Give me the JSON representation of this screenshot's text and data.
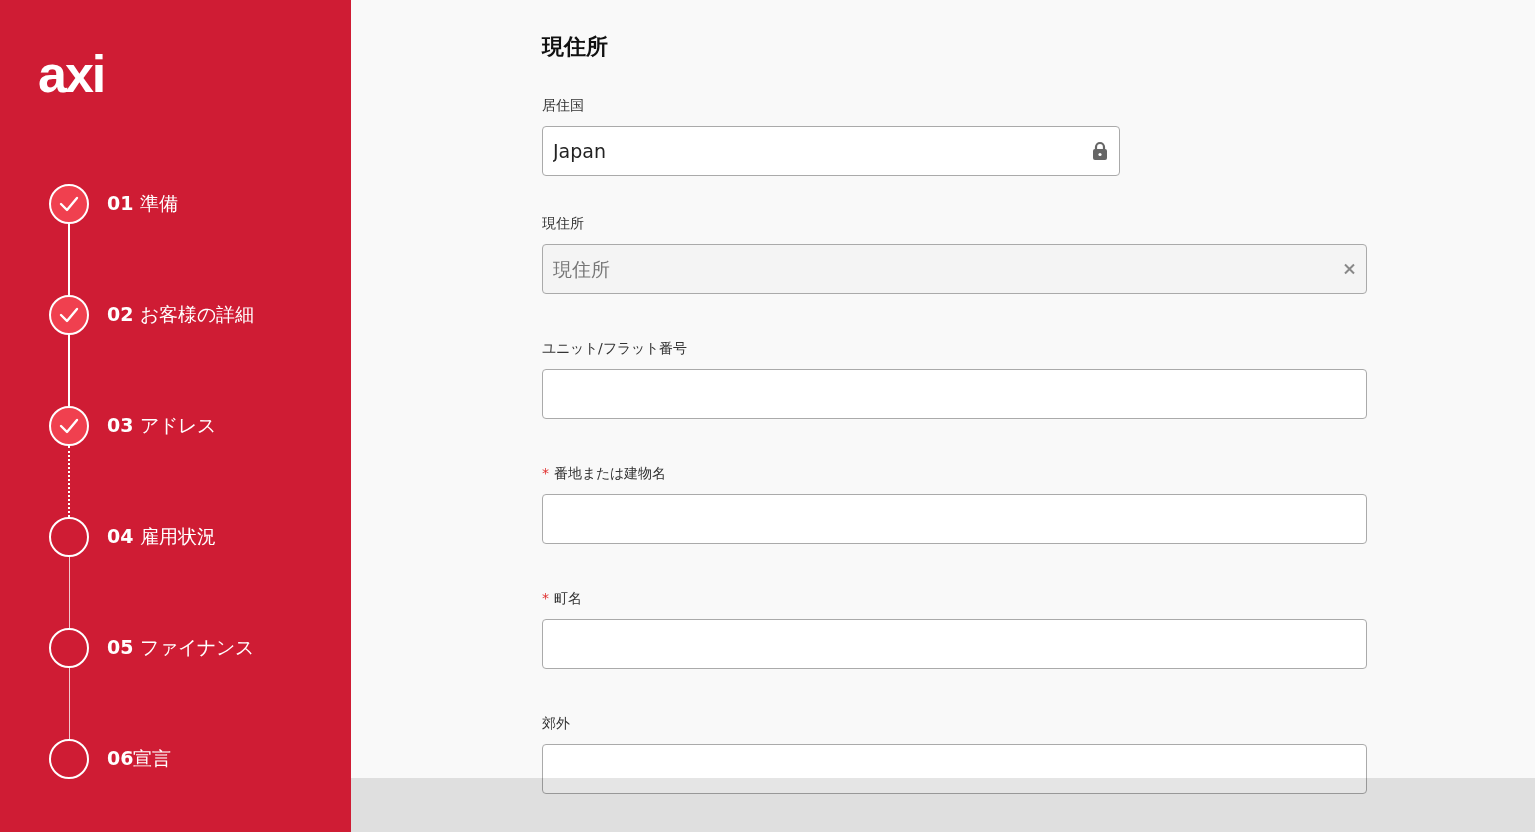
{
  "sidebar": {
    "logo": "axi",
    "steps": [
      {
        "number": "01",
        "label": "準備",
        "done": true
      },
      {
        "number": "02",
        "label": "お客様の詳細",
        "done": true
      },
      {
        "number": "03",
        "label": "アドレス",
        "done": true
      },
      {
        "number": "04",
        "label": "雇用状況",
        "done": false
      },
      {
        "number": "05",
        "label": "ファイナンス",
        "done": false
      },
      {
        "number": "06",
        "label": "宣言",
        "done": false,
        "tight": true
      }
    ]
  },
  "form": {
    "title": "現住所",
    "fields": [
      {
        "kind": "locked",
        "label": "居住国",
        "required": false,
        "value": "Japan"
      },
      {
        "kind": "clearable",
        "label": "現住所",
        "required": false,
        "placeholder": "現住所"
      },
      {
        "kind": "text",
        "label": "ユニット/フラット番号",
        "required": false
      },
      {
        "kind": "text",
        "label": "番地または建物名",
        "required": true,
        "required_mark": "*"
      },
      {
        "kind": "text",
        "label": "町名",
        "required": true,
        "required_mark": "*"
      },
      {
        "kind": "text",
        "label": "郊外",
        "required": false
      }
    ]
  }
}
